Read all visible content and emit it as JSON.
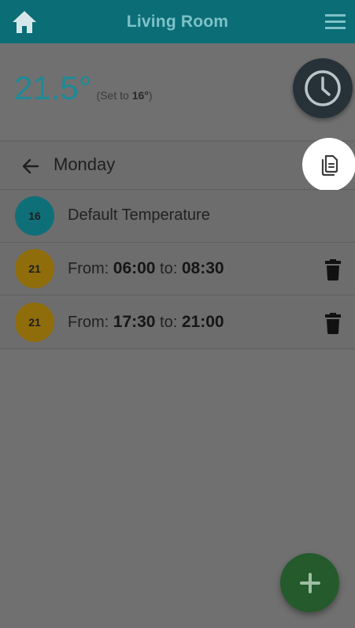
{
  "header": {
    "title": "Living Room",
    "home_icon": "home-icon",
    "menu_icon": "hamburger-menu-icon",
    "background_color": "#0b6d76"
  },
  "status": {
    "current_temperature": "21.5°",
    "set_to_prefix": "(Set to ",
    "set_to_value": "16°",
    "set_to_suffix": ")",
    "schedule_icon": "clock-icon"
  },
  "day": {
    "label": "Monday",
    "back_icon": "arrow-left-icon",
    "copy_icon": "copy-icon"
  },
  "list": {
    "default": {
      "temperature": "16",
      "label": "Default Temperature",
      "badge_color": "#0f6f79"
    },
    "periods": [
      {
        "temperature": "21",
        "from_label": "From: ",
        "from_time": "06:00",
        "to_label": " to: ",
        "to_time": "08:30",
        "badge_color": "#8f6d0a",
        "delete_icon": "trash-icon"
      },
      {
        "temperature": "21",
        "from_label": "From: ",
        "from_time": "17:30",
        "to_label": " to: ",
        "to_time": "21:00",
        "badge_color": "#8f6d0a",
        "delete_icon": "trash-icon"
      }
    ]
  },
  "fab": {
    "icon": "plus-icon",
    "color": "#245a2c"
  }
}
